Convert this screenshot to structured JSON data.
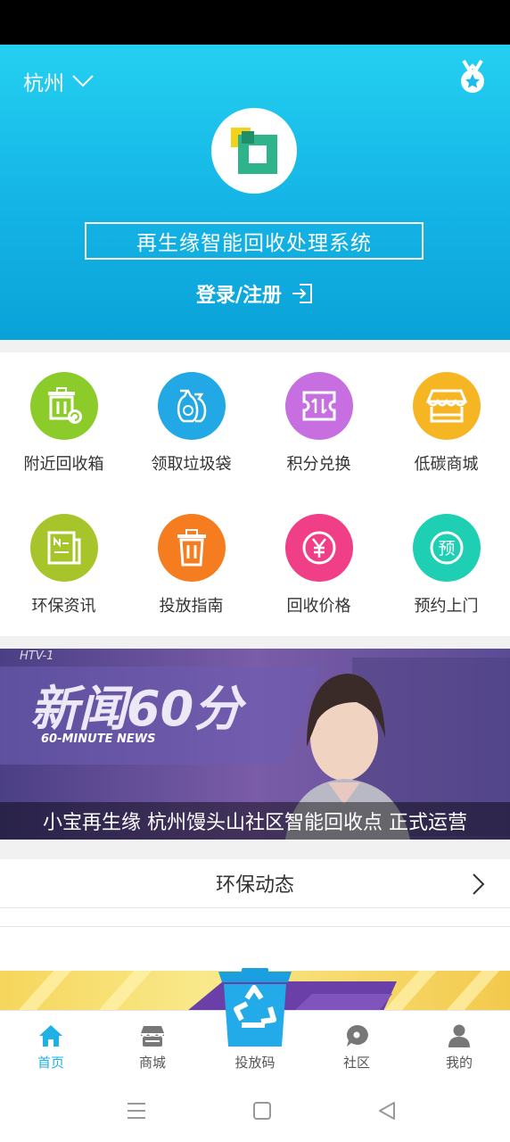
{
  "header": {
    "city": "杭州",
    "app_title": "再生缘智能回收处理系统",
    "login_label": "登录/注册"
  },
  "menu": [
    {
      "label": "附近回收箱",
      "icon": "recycle-bin-icon",
      "color": "#8ccc2a"
    },
    {
      "label": "领取垃圾袋",
      "icon": "garbage-bags-icon",
      "color": "#22a8e4"
    },
    {
      "label": "积分兑换",
      "icon": "points-exchange-icon",
      "color": "#c76fe0"
    },
    {
      "label": "低碳商城",
      "icon": "store-icon",
      "color": "#f6b623"
    },
    {
      "label": "环保资讯",
      "icon": "news-icon",
      "color": "#a7c52a"
    },
    {
      "label": "投放指南",
      "icon": "trash-can-icon",
      "color": "#f57c1f"
    },
    {
      "label": "回收价格",
      "icon": "yen-icon",
      "color": "#f03f86"
    },
    {
      "label": "预约上门",
      "icon": "appointment-icon",
      "color": "#1fcfb3"
    }
  ],
  "banner": {
    "caption": "小宝再生缘 杭州馒头山社区智能回收点 正式运营",
    "show_title": "新闻60分",
    "show_subtitle": "60-MINUTE NEWS",
    "channel": "HTV-1"
  },
  "section": {
    "title": "环保动态"
  },
  "tabs": [
    {
      "label": "首页",
      "icon": "home-icon",
      "active": true
    },
    {
      "label": "商城",
      "icon": "shop-icon",
      "active": false
    },
    {
      "label": "投放码",
      "icon": "recycle-bin-icon",
      "active": false
    },
    {
      "label": "社区",
      "icon": "chat-bubble-icon",
      "active": false
    },
    {
      "label": "我的",
      "icon": "user-icon",
      "active": false
    }
  ],
  "colors": {
    "accent": "#1fb0e6",
    "hero_top": "#24d0f0",
    "hero_bottom": "#0aa2d8"
  }
}
